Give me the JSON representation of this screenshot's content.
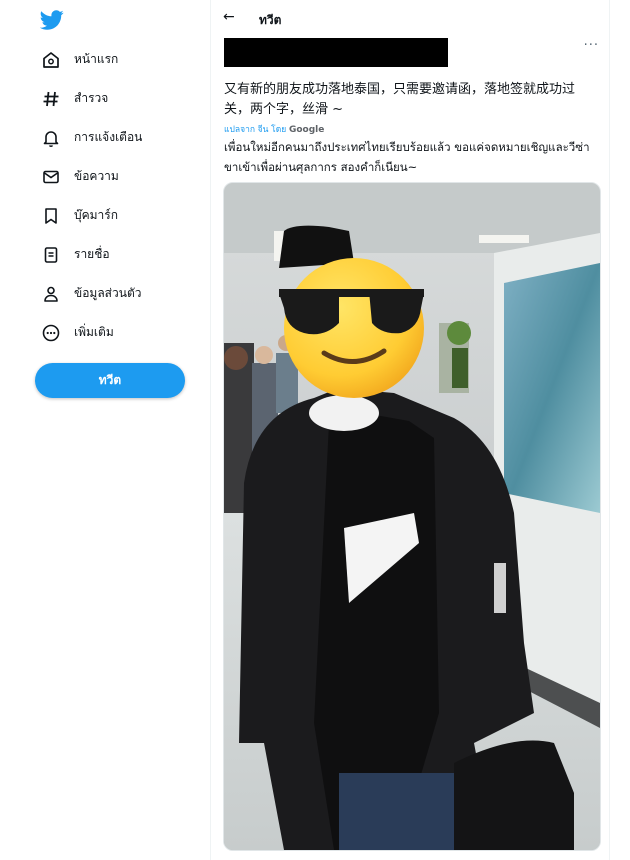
{
  "sidebar": {
    "logo_icon": "twitter-bird-icon",
    "items": [
      {
        "label": "หน้าแรก",
        "icon": "home-icon"
      },
      {
        "label": "สำรวจ",
        "icon": "hashtag-icon"
      },
      {
        "label": "การแจ้งเตือน",
        "icon": "bell-icon"
      },
      {
        "label": "ข้อความ",
        "icon": "mail-icon"
      },
      {
        "label": "บุ๊คมาร์ก",
        "icon": "bookmark-icon"
      },
      {
        "label": "รายชื่อ",
        "icon": "list-icon"
      },
      {
        "label": "ข้อมูลส่วนตัว",
        "icon": "profile-icon"
      },
      {
        "label": "เพิ่มเติม",
        "icon": "more-circle-icon"
      }
    ],
    "tweet_button": "ทวีต"
  },
  "header": {
    "back_icon": "←",
    "title": "ทวีต"
  },
  "tweet": {
    "more_icon": "···",
    "text_original": "又有新的朋友成功落地泰国，只需要邀请函，落地签就成功过关，两个字，丝滑 ~",
    "translated_by": "แปลจาก จีน โดย",
    "translator": "Google",
    "text_translated": "เพื่อนใหม่อีกคนมาถึงประเทศไทยเรียบร้อยแล้ว ขอแค่จดหมายเชิญและวีซ่าขาเข้าเพื่อผ่านศุลกากร สองคำก็เนียน~",
    "media_emoji": "sunglasses-face-emoji"
  },
  "colors": {
    "accent": "#1d9bf0",
    "text": "#0f1419",
    "muted": "#536471",
    "emoji_yellow": "#ffcc33"
  }
}
